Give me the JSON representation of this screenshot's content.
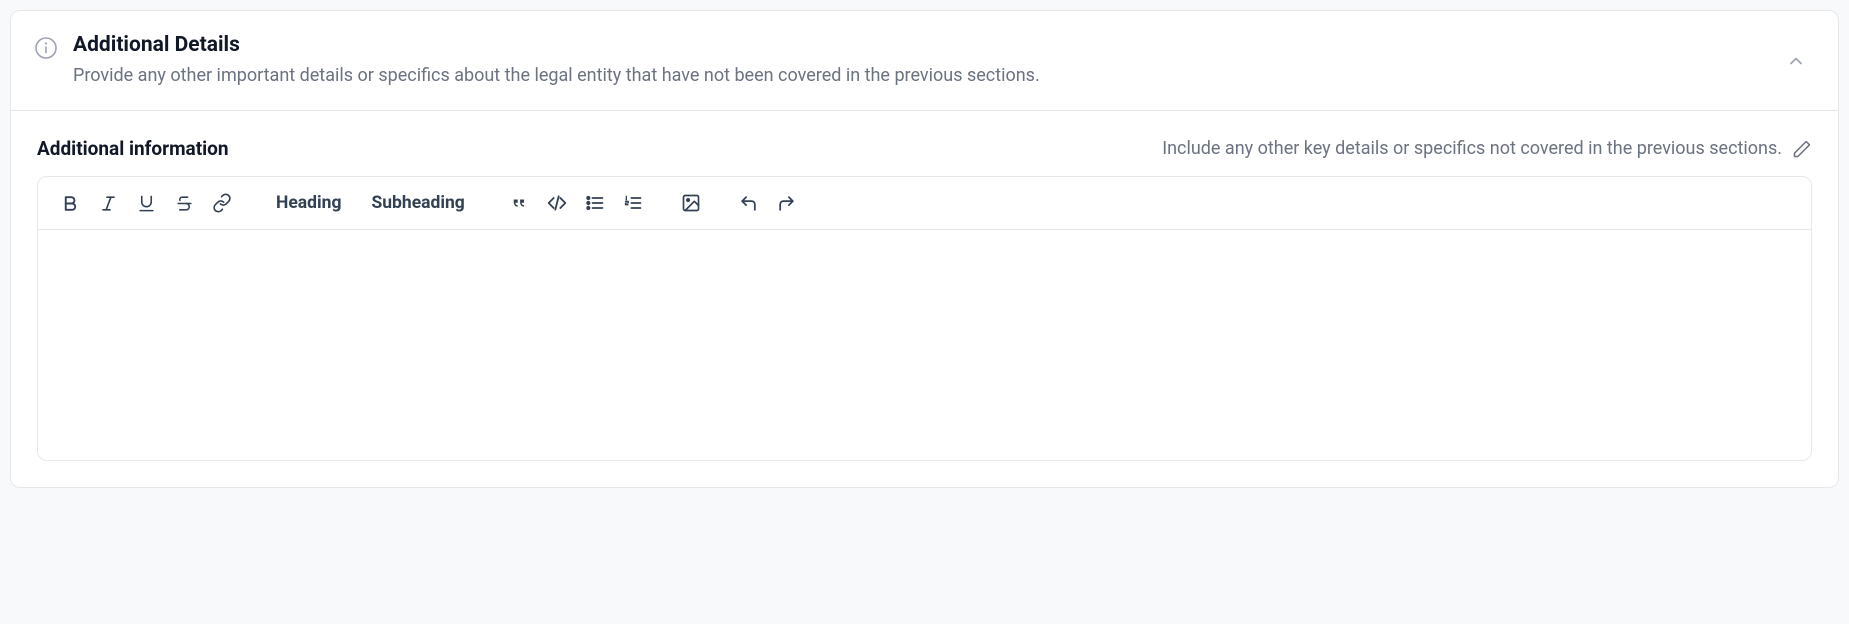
{
  "header": {
    "title": "Additional Details",
    "description": "Provide any other important details or specifics about the legal entity that have not been covered in the previous sections."
  },
  "field": {
    "label": "Additional information",
    "hint": "Include any other key details or specifics not covered in the previous sections."
  },
  "toolbar": {
    "heading": "Heading",
    "subheading": "Subheading"
  },
  "editor": {
    "value": ""
  }
}
